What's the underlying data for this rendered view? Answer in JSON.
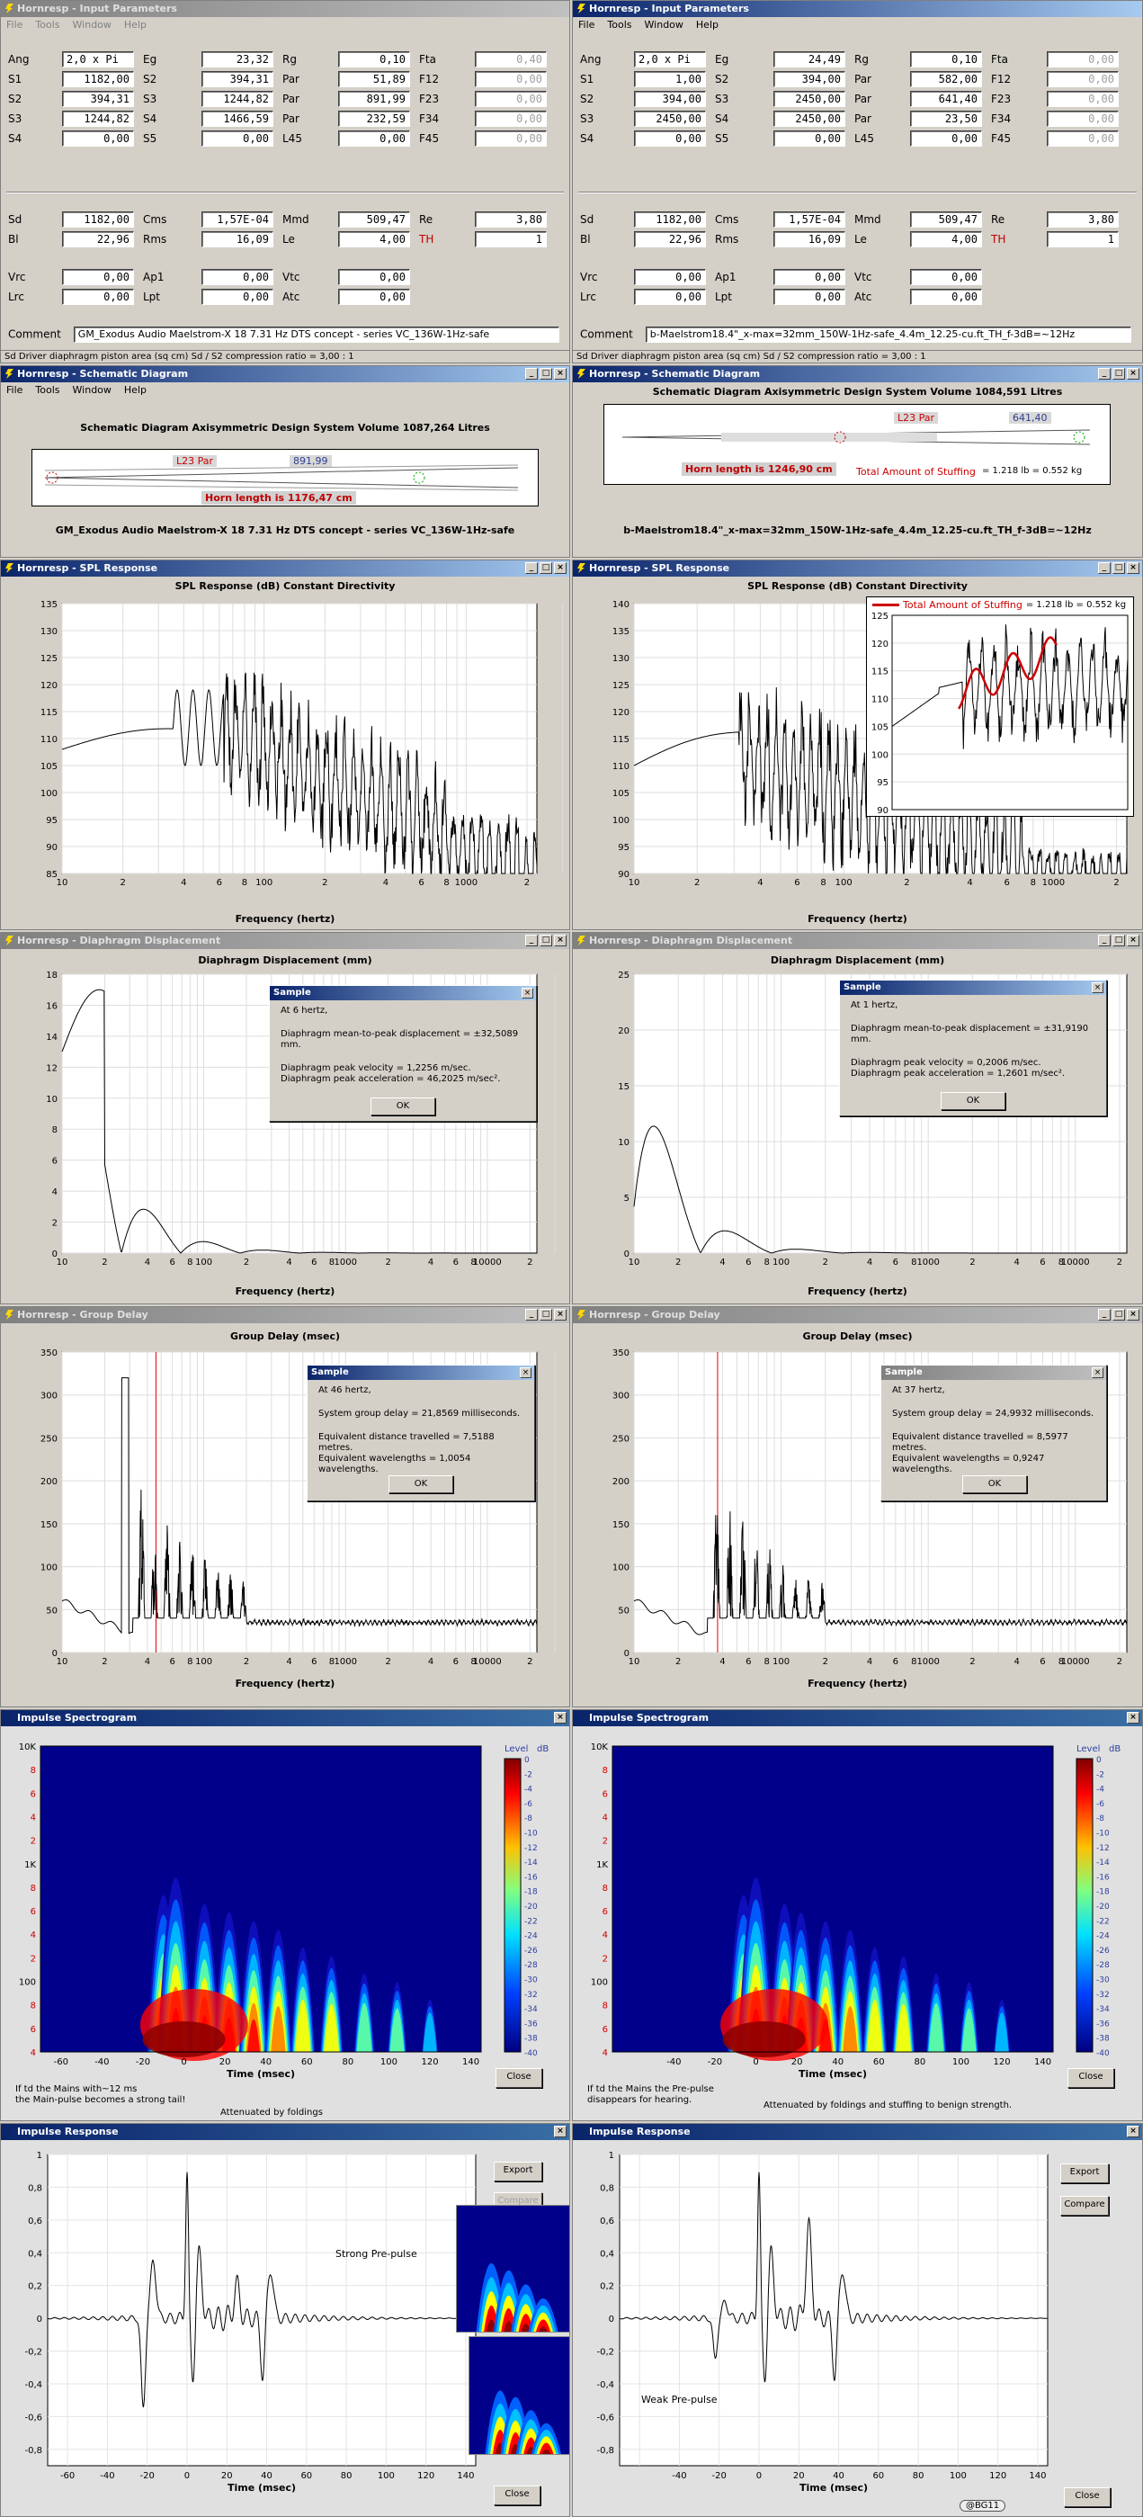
{
  "app": {
    "menu_left": [
      "File",
      "Tools",
      "Window",
      "Help"
    ],
    "menu_right": [
      "File",
      "Tools",
      "Window",
      "Help"
    ]
  },
  "input": {
    "left": {
      "title": "Hornresp - Input Parameters",
      "rows": [
        [
          "Ang",
          "2,0 x Pi",
          "Eg",
          "23,32",
          "Rg",
          "0,10",
          "Fta",
          "0,40"
        ],
        [
          "S1",
          "1182,00",
          "S2",
          "394,31",
          "Par",
          "51,89",
          "F12",
          "0,00"
        ],
        [
          "S2",
          "394,31",
          "S3",
          "1244,82",
          "Par",
          "891,99",
          "F23",
          "0,00"
        ],
        [
          "S3",
          "1244,82",
          "S4",
          "1466,59",
          "Par",
          "232,59",
          "F34",
          "0,00"
        ],
        [
          "S4",
          "0,00",
          "S5",
          "0,00",
          "L45",
          "0,00",
          "F45",
          "0,00"
        ]
      ],
      "rows2": [
        [
          "Sd",
          "1182,00",
          "Cms",
          "1,57E-04",
          "Mmd",
          "509,47",
          "Re",
          "3,80"
        ],
        [
          "Bl",
          "22,96",
          "Rms",
          "16,09",
          "Le",
          "4,00",
          "TH",
          "1"
        ]
      ],
      "rows3": [
        [
          "Vrc",
          "0,00",
          "Ap1",
          "0,00",
          "Vtc",
          "0,00"
        ],
        [
          "Lrc",
          "0,00",
          "Lpt",
          "0,00",
          "Atc",
          "0,00"
        ]
      ],
      "comment_label": "Comment",
      "comment": "GM_Exodus Audio Maelstrom-X 18 7.31 Hz DTS concept - series VC_136W-1Hz-safe",
      "status": "Sd  Driver diaphragm piston area  (sq cm)   Sd / S2 compression ratio = 3,00 : 1"
    },
    "right": {
      "title": "Hornresp - Input Parameters",
      "rows": [
        [
          "Ang",
          "2,0 x Pi",
          "Eg",
          "24,49",
          "Rg",
          "0,10",
          "Fta",
          "0,00"
        ],
        [
          "S1",
          "1,00",
          "S2",
          "394,00",
          "Par",
          "582,00",
          "F12",
          "0,00"
        ],
        [
          "S2",
          "394,00",
          "S3",
          "2450,00",
          "Par",
          "641,40",
          "F23",
          "0,00"
        ],
        [
          "S3",
          "2450,00",
          "S4",
          "2450,00",
          "Par",
          "23,50",
          "F34",
          "0,00"
        ],
        [
          "S4",
          "0,00",
          "S5",
          "0,00",
          "L45",
          "0,00",
          "F45",
          "0,00"
        ]
      ],
      "rows2": [
        [
          "Sd",
          "1182,00",
          "Cms",
          "1,57E-04",
          "Mmd",
          "509,47",
          "Re",
          "3,80"
        ],
        [
          "Bl",
          "22,96",
          "Rms",
          "16,09",
          "Le",
          "4,00",
          "TH",
          "1"
        ]
      ],
      "rows3": [
        [
          "Vrc",
          "0,00",
          "Ap1",
          "0,00",
          "Vtc",
          "0,00"
        ],
        [
          "Lrc",
          "0,00",
          "Lpt",
          "0,00",
          "Atc",
          "0,00"
        ]
      ],
      "comment_label": "Comment",
      "comment": "b-Maelstrom18.4\"_x-max=32mm_150W-1Hz-safe_4.4m_12.25-cu.ft_TH_f-3dB=~12Hz",
      "status": "Sd  Driver diaphragm piston area  (sq cm)   Sd / S2 compression ratio = 3,00 : 1"
    }
  },
  "schematic": {
    "left": {
      "title": "Hornresp - Schematic Diagram",
      "heading": "Schematic Diagram   Axisymmetric Design   System Volume 1087,264 Litres",
      "seg": "L23  Par",
      "segval": "891,99",
      "horn": "Horn length is 1176,47 cm",
      "caption": "GM_Exodus Audio Maelstrom-X 18 7.31 Hz DTS concept - series VC_136W-1Hz-safe"
    },
    "right": {
      "title": "Hornresp - Schematic Diagram",
      "heading": "Schematic Diagram   Axisymmetric Design   System Volume 1084,591 Litres",
      "seg": "L23  Par",
      "segval": "641,40",
      "horn": "Horn length is 1246,90 cm",
      "stuff_label": "Total Amount of Stuffing",
      "stuff_val": "= 1.218 lb = 0.552 kg",
      "caption": "b-Maelstrom18.4\"_x-max=32mm_150W-1Hz-safe_4.4m_12.25-cu.ft_TH_f-3dB=~12Hz"
    }
  },
  "spl": {
    "left": {
      "title": "Hornresp - SPL Response",
      "heading": "SPL Response (dB)   Constant Directivity",
      "xlabel": "Frequency (hertz)"
    },
    "right": {
      "title": "Hornresp - SPL Response",
      "heading": "SPL Response (dB)   Constant Directivity",
      "xlabel": "Frequency (hertz)",
      "inset_label": "Total Amount of Stuffing",
      "inset_val": "= 1.218 lb = 0.552 kg"
    }
  },
  "disp": {
    "left": {
      "title": "Hornresp - Diaphragm Displacement",
      "heading": "Diaphragm Displacement (mm)",
      "xlabel": "Frequency (hertz)",
      "dlg_title": "Sample",
      "l1": "At 6 hertz,",
      "l2": "Diaphragm mean-to-peak displacement = ±32,5089 mm.",
      "l3": "Diaphragm peak velocity = 1,2256 m/sec.",
      "l4": "Diaphragm peak acceleration = 46,2025 m/sec².",
      "ok": "OK"
    },
    "right": {
      "title": "Hornresp - Diaphragm Displacement",
      "heading": "Diaphragm Displacement (mm)",
      "xlabel": "Frequency (hertz)",
      "dlg_title": "Sample",
      "l1": "At 1 hertz,",
      "l2": "Diaphragm mean-to-peak displacement = ±31,9190 mm.",
      "l3": "Diaphragm peak velocity = 0,2006 m/sec.",
      "l4": "Diaphragm peak acceleration = 1,2601 m/sec².",
      "ok": "OK"
    }
  },
  "gd": {
    "left": {
      "title": "Hornresp - Group Delay",
      "heading": "Group Delay (msec)",
      "xlabel": "Frequency (hertz)",
      "dlg_title": "Sample",
      "l1": "At 46 hertz,",
      "l2": "System group delay = 21,8569 milliseconds.",
      "l3": "Equivalent distance travelled = 7,5188 metres.",
      "l4": "Equivalent wavelengths = 1,0054 wavelengths.",
      "ok": "OK"
    },
    "right": {
      "title": "Hornresp - Group Delay",
      "heading": "Group Delay (msec)",
      "xlabel": "Frequency (hertz)",
      "dlg_title": "Sample",
      "l1": "At 37 hertz,",
      "l2": "System group delay = 24,9932 milliseconds.",
      "l3": "Equivalent distance travelled = 8,5977 metres.",
      "l4": "Equivalent wavelengths = 0,9247 wavelengths.",
      "ok": "OK"
    }
  },
  "spec": {
    "left": {
      "title": "Impulse Spectrogram",
      "level": "Level",
      "db": "dB",
      "xlabel": "Time (msec)",
      "close": "Close",
      "note1": "If td the Mains with~12 ms",
      "note2": "the Main-pulse becomes a strong tail!",
      "note3": "Attenuated by foldings"
    },
    "right": {
      "title": "Impulse Spectrogram",
      "level": "Level",
      "db": "dB",
      "xlabel": "Time (msec)",
      "close": "Close",
      "note1": "If td the Mains the Pre-pulse",
      "note2": "disappears for hearing.",
      "note3": "Attenuated by foldings and stuffing to benign strength."
    }
  },
  "imp": {
    "left": {
      "title": "Impulse Response",
      "xlabel": "Time (msec)",
      "export": "Export",
      "compare": "Compare",
      "close": "Close",
      "note": "Strong Pre-pulse"
    },
    "right": {
      "title": "Impulse Response",
      "xlabel": "Time (msec)",
      "export": "Export",
      "compare": "Compare",
      "close": "Close",
      "note": "Weak Pre-pulse",
      "badge": "@BG11"
    }
  },
  "axes": {
    "freq_ticks": [
      "10",
      "2",
      "4",
      "6",
      "8",
      "100",
      "2",
      "4",
      "6",
      "8",
      "1000",
      "2"
    ],
    "freq_ticks_disp": [
      "10",
      "2",
      "4",
      "6",
      "8",
      "100",
      "2",
      "4",
      "6",
      "8",
      "1000",
      "2",
      "4",
      "6",
      "8",
      "10000",
      "2"
    ],
    "freq_ticks_gd": [
      "10",
      "2",
      "4",
      "6",
      "8",
      "100",
      "2",
      "4",
      "6",
      "8",
      "1000",
      "2",
      "4",
      "6",
      "8",
      "10000",
      "2"
    ],
    "spl_left_y": [
      "135",
      "130",
      "125",
      "120",
      "115",
      "110",
      "105",
      "100",
      "95",
      "90",
      "85"
    ],
    "spl_right_y": [
      "140",
      "135",
      "130",
      "125",
      "120",
      "115",
      "110",
      "105",
      "100",
      "95",
      "90"
    ],
    "inset_y": [
      "125",
      "120",
      "115",
      "110",
      "105",
      "100",
      "95",
      "90"
    ],
    "disp_left_y": [
      "18",
      "16",
      "14",
      "12",
      "10",
      "8",
      "6",
      "4",
      "2",
      "0"
    ],
    "disp_right_y": [
      "25",
      "20",
      "15",
      "10",
      "5",
      "0"
    ],
    "gd_y": [
      "350",
      "300",
      "250",
      "200",
      "150",
      "100",
      "50",
      "0"
    ],
    "spec_y": [
      "10K",
      "8",
      "6",
      "4",
      "2",
      "1K",
      "8",
      "6",
      "4",
      "2",
      "100",
      "8",
      "6",
      "4"
    ],
    "spec_x_left": [
      "-60",
      "-40",
      "-20",
      "0",
      "20",
      "40",
      "60",
      "80",
      "100",
      "120",
      "140"
    ],
    "spec_x_right": [
      "-40",
      "-20",
      "0",
      "20",
      "40",
      "60",
      "80",
      "100",
      "120",
      "140"
    ],
    "level_ticks": [
      "0",
      "-2",
      "-4",
      "-6",
      "-8",
      "-10",
      "-12",
      "-14",
      "-16",
      "-18",
      "-20",
      "-22",
      "-24",
      "-26",
      "-28",
      "-30",
      "-32",
      "-34",
      "-36",
      "-38",
      "-40"
    ],
    "imp_y": [
      "1",
      "0,8",
      "0,6",
      "0,4",
      "0,2",
      "0",
      "-0,2",
      "-0,4",
      "-0,6",
      "-0,8"
    ],
    "imp_x_left": [
      "-60",
      "-40",
      "-20",
      "0",
      "20",
      "40",
      "60",
      "80",
      "100",
      "120",
      "140"
    ],
    "imp_x_right": [
      "-40",
      "-20",
      "0",
      "20",
      "40",
      "60",
      "80",
      "100",
      "120",
      "140"
    ]
  },
  "colors": {
    "title_active": "#0a246a",
    "title_inactive": "#808080",
    "trace": "#000000",
    "cursor": "#e00000"
  }
}
